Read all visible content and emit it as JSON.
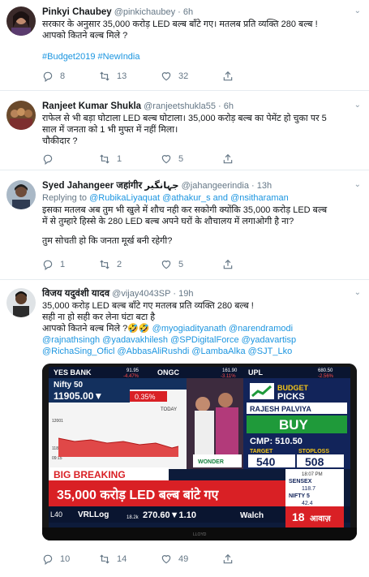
{
  "tweets": [
    {
      "name": "Pinkyi Chaubey",
      "handle": "@pinkichaubey",
      "time": "6h",
      "lines": [
        "सरकार के अनुसार 35,000 करोड़ LED बल्ब बाँटे गए। मतलब प्रति व्यक्ति 280 बल्ब !",
        "आपको कितने बल्ब मिले ?"
      ],
      "hashtags": "#Budget2019 #NewIndia",
      "replies": "8",
      "retweets": "13",
      "likes": "32"
    },
    {
      "name": "Ranjeet Kumar Shukla",
      "handle": "@ranjeetshukla55",
      "time": "6h",
      "lines": [
        "राफेल से भी बड़ा घोटाला LED बल्ब घोटाला। 35,000 करोड़ बल्ब का पेमेंट हो चुका पर 5",
        "साल में जनता को 1 भी मुफ्त में नहीं मिला।",
        "चौकीदार ?"
      ],
      "replies": "",
      "retweets": "1",
      "likes": "5"
    },
    {
      "name": "Syed Jahangeer जहांगीर جہانگیر",
      "handle": "@jahangeerindia",
      "time": "13h",
      "replying_prefix": "Replying to ",
      "replying_targets": "@RubikaLiyaquat @athakur_s and @nsitharaman",
      "lines": [
        "इसका मतलब अब तुम भी खुले में शौच नही कर सकोगी क्योंकि 35,000 करोड़ LED बल्ब",
        "में से तुम्हारे हिस्से के 280 LED बल्ब अपने घरों के शौचालय में लगाओगी है ना?"
      ],
      "lines2": "तुम सोचती हो कि जनता मूर्ख बनी रहेगी?",
      "replies": "1",
      "retweets": "2",
      "likes": "5"
    },
    {
      "name": "विजय यदुवंशी यादव",
      "handle": "@vijay4043SP",
      "time": "19h",
      "lines": [
        "35,000 करोड़ LED बल्ब बाँटे गए मतलब प्रति व्यक्ति 280 बल्ब !",
        "सही ना हो सही कर लेना घंटा बटा है"
      ],
      "mention_line_prefix": "आपको कितने बल्ब मिले ?🤣🤣 ",
      "mentions1": "@myogiadityanath @narendramodi",
      "mentions2": "@rajnathsingh @yadavakhilesh @SPDigitalForce @yadavartisp",
      "mentions3": "@RichaSing_Oficl @AbbasAliRushdi @LambaAlka @SJT_Lko",
      "replies": "10",
      "retweets": "14",
      "likes": "49"
    }
  ],
  "media": {
    "ticker_top": [
      "YES BANK",
      "91.95",
      "-4.47%",
      "ONGC",
      "161.90",
      "-3.11%",
      "UPL",
      "680.50",
      "-2.56%"
    ],
    "nifty_label": "Nifty 50",
    "nifty_value": "11905.00▼",
    "nifty_change": "0.35%",
    "today": "TODAY",
    "y_high": "12001",
    "y_low": "11877",
    "x_start": "09:15",
    "budget_title": "BUDGET",
    "picks": "PICKS",
    "analyst": "RAJESH PALVIYA",
    "buy": "BUY",
    "cmp": "CMP: 510.50",
    "target_label": "TARGET",
    "stoploss_label": "STOPLOSS",
    "target_value": "540",
    "stoploss_value": "508",
    "time_clock": "18:07 PM",
    "sensex_label": "SENSEX",
    "sensex_value": "118.7",
    "nifty5_label": "NIFTY 5",
    "nifty5_value": "42.4",
    "big_breaking": "BIG BREAKING",
    "headline": "35,000 करोड़ LED बल्ब बांटे गए",
    "bottom_left": "L40",
    "vrl": "VRLLog",
    "bottom_mid": "18.2k",
    "bottom_price": "270.60▼1.10",
    "walch": "Walch",
    "brand": "आवाज़",
    "brand_num": "18",
    "logo_text": "WONDER",
    "tv_brand": "LLOYD"
  },
  "colors": {
    "link": "#1b95e0",
    "reply": "#657786",
    "accent_red": "#d92025",
    "accent_yellow": "#f5c518"
  }
}
